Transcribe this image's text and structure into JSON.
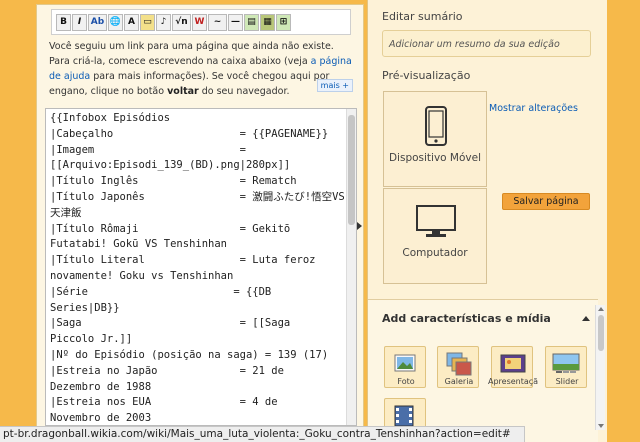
{
  "toolbar": {
    "buttons": [
      {
        "name": "bold",
        "label": "B"
      },
      {
        "name": "italic",
        "label": "I"
      },
      {
        "name": "internal-link",
        "label": "Ab"
      },
      {
        "name": "external-link",
        "label": "🌐"
      },
      {
        "name": "heading",
        "label": "A"
      },
      {
        "name": "image",
        "label": "▭"
      },
      {
        "name": "media",
        "label": "♪"
      },
      {
        "name": "math",
        "label": "√n"
      },
      {
        "name": "nowiki",
        "label": "W"
      },
      {
        "name": "signature",
        "label": "~"
      },
      {
        "name": "horizontal-line",
        "label": "—"
      },
      {
        "name": "template",
        "label": "▤"
      },
      {
        "name": "gallery",
        "label": "▦"
      },
      {
        "name": "table",
        "label": "⊞"
      }
    ]
  },
  "notice": {
    "text_before_link": "Você seguiu um link para uma página que ainda não existe. Para criá-la, comece escrevendo na caixa abaixo (veja ",
    "help_link": "a página de ajuda",
    "text_after_link": " para mais informações). Se você chegou aqui por engano, clique no botão ",
    "back_button_word": "voltar",
    "text_end": " do seu navegador.",
    "more_label": "mais +"
  },
  "editor": {
    "content": "{{Infobox Episódios\n|Cabeçalho                    = {{PAGENAME}}\n|Imagem                       =\n[[Arquivo:Episodi_139_(BD).png|280px]]\n|Título Inglês                = Rematch\n|Título Japonês               = 激闘ふたび!悟空VS天津飯\n|Título Rômaji                = Gekitō\nFutatabi! Gokū VS Tenshinhan\n|Título Literal               = Luta feroz\nnovamente! Goku vs Tenshinhan\n|Série                       = {{DB\nSeries|DB}}\n|Saga                         = [[Saga\nPiccolo Jr.]]\n|Nº do Episódio (posição na saga) = 139 (17)\n|Estreia no Japão             = 21 de\nDezembro de 1988\n|Estreia nos EUA              = 4 de\nNovembro de 2003\n|Estreia no Brasil            =\n|Episódio Anterior            = [["
  },
  "summary": {
    "label": "Editar sumário",
    "placeholder": "Adicionar um resumo da sua edição"
  },
  "preview": {
    "label": "Pré-visualização",
    "mobile_label": "Dispositivo Móvel",
    "desktop_label": "Computador",
    "show_changes": "Mostrar alterações"
  },
  "save_button": "Salvar página",
  "features": {
    "header": "Add características e mídia",
    "items": [
      {
        "name": "photo",
        "label": "Foto"
      },
      {
        "name": "gallery",
        "label": "Galeria"
      },
      {
        "name": "slideshow",
        "label": "Apresentação"
      },
      {
        "name": "slider",
        "label": "Slider"
      },
      {
        "name": "video",
        "label": ""
      }
    ]
  },
  "status_bar": {
    "url": "pt-br.dragonball.wikia.com/wiki/Mais_uma_luta_violenta:_Goku_contra_Tenshinhan?action=edit#"
  },
  "colors": {
    "page_background": "#f6b94a",
    "link": "#0b5cb5",
    "save_button": "#f2a33b"
  }
}
